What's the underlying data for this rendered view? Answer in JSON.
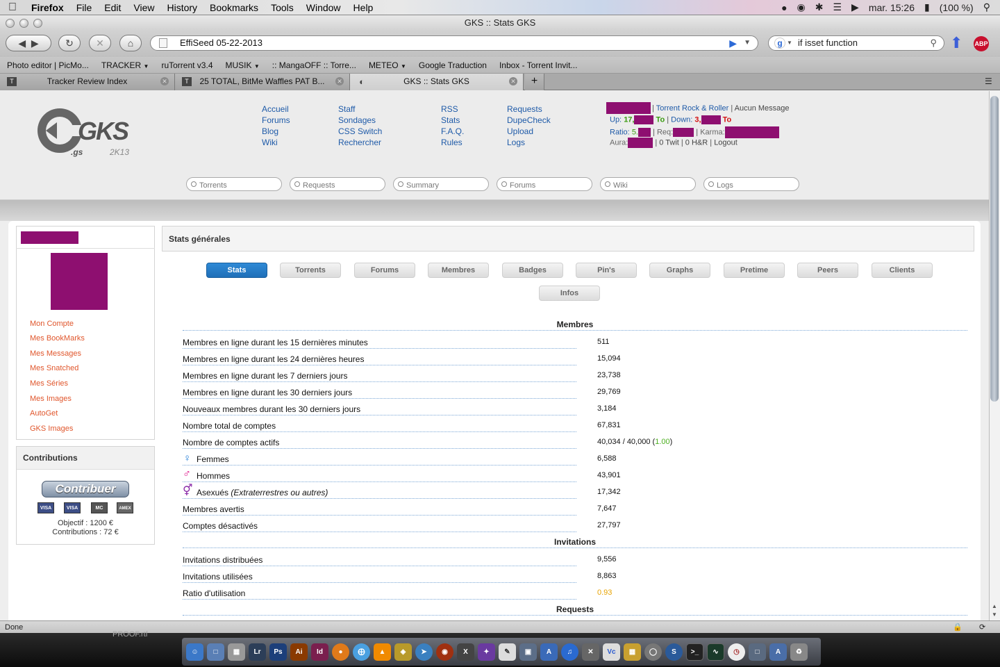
{
  "menubar": {
    "app": "Firefox",
    "items": [
      "File",
      "Edit",
      "View",
      "History",
      "Bookmarks",
      "Tools",
      "Window",
      "Help"
    ],
    "clock": "mar. 15:26",
    "battery": "(100 %)"
  },
  "window": {
    "title": "GKS :: Stats GKS"
  },
  "navbar": {
    "url": "EffiSeed 05-22-2013",
    "search_value": "if isset function"
  },
  "bookmarks": [
    "Photo editor | PicMo...",
    "TRACKER",
    "ruTorrent v3.4",
    "MUSIK",
    ":: MangaOFF :: Torre...",
    "METEO",
    "Google Traduction",
    "Inbox - Torrent Invit..."
  ],
  "tabs": [
    {
      "label": "Tracker Review Index"
    },
    {
      "label": "25 TOTAL, BitMe Waffles PAT B..."
    },
    {
      "label": "GKS :: Stats GKS"
    }
  ],
  "site": {
    "logo": {
      "main": "GKS",
      "sub": ".gs",
      "year": "2K13"
    },
    "nav": {
      "col1": [
        "Accueil",
        "Forums",
        "Blog",
        "Wiki"
      ],
      "col2": [
        "Staff",
        "Sondages",
        "CSS Switch",
        "Rechercher"
      ],
      "col3": [
        "RSS",
        "Stats",
        "F.A.Q.",
        "Rules"
      ],
      "col4": [
        "Requests",
        "DupeCheck",
        "Upload",
        "Logs"
      ]
    },
    "user": {
      "rank": "Torrent Rock & Roller",
      "messages": "Aucun Message",
      "up_label": "Up:",
      "up_value": "17,",
      "up_unit": "To",
      "down_label": "Down:",
      "down_value": "3,",
      "down_unit": "To",
      "ratio_label": "Ratio:",
      "ratio_value": "5.",
      "req_label": "Req:",
      "karma_label": "Karma:",
      "aura_label": "Aura:",
      "twit": "0 Twit",
      "hr": "0 H&R",
      "logout": "Logout"
    },
    "search_placeholders": [
      "Torrents",
      "Requests",
      "Summary",
      "Forums",
      "Wiki",
      "Logs"
    ]
  },
  "sidebar": {
    "links": [
      "Mon Compte",
      "Mes BookMarks",
      "Mes Messages",
      "Mes Snatched",
      "Mes Séries",
      "Mes Images",
      "AutoGet",
      "GKS Images"
    ],
    "contrib_title": "Contributions",
    "contrib_button": "Contribuer",
    "cards": [
      "VISA",
      "VISA",
      "MC",
      "AMEX"
    ],
    "objectif": "Objectif : 1200 €",
    "contributions": "Contributions : 72 €"
  },
  "panel": {
    "title": "Stats générales",
    "tabs": [
      "Stats",
      "Torrents",
      "Forums",
      "Membres",
      "Badges",
      "Pin's",
      "Graphs",
      "Pretime",
      "Peers",
      "Clients",
      "Infos"
    ],
    "active_tab": "Stats",
    "sections": {
      "members": "Membres",
      "invitations": "Invitations",
      "requests": "Requests"
    },
    "member_rows": [
      {
        "label": "Membres en ligne durant les 15 dernières minutes",
        "value": "511"
      },
      {
        "label": "Membres en ligne durant les 24 dernières heures",
        "value": "15,094"
      },
      {
        "label": "Membres en ligne durant les 7 derniers jours",
        "value": "23,738"
      },
      {
        "label": "Membres en ligne durant les 30 derniers jours",
        "value": "29,769"
      },
      {
        "label": "Nouveaux membres durant les 30 derniers jours",
        "value": "3,184"
      },
      {
        "label": "Nombre total de comptes",
        "value": "67,831"
      },
      {
        "label": "Nombre de comptes actifs",
        "value": "40,034 / 40,000 (",
        "extra": "1.00",
        "tail": ")"
      },
      {
        "label": "Femmes",
        "value": "6,588",
        "icon": "female-icon"
      },
      {
        "label": "Hommes",
        "value": "43,901",
        "icon": "male-icon"
      },
      {
        "label": "Asexués",
        "label_em": "(Extraterrestres ou autres)",
        "value": "17,342",
        "icon": "asexual-icon"
      },
      {
        "label": "Membres avertis",
        "value": "7,647"
      },
      {
        "label": "Comptes désactivés",
        "value": "27,797"
      }
    ],
    "invitation_rows": [
      {
        "label": "Invitations distribuées",
        "value": "9,556"
      },
      {
        "label": "Invitations utilisées",
        "value": "8,863"
      },
      {
        "label": "Ratio d'utilisation",
        "value": "0.93"
      }
    ]
  },
  "status": {
    "text": "Done",
    "dock_label": "PROOF.rtf"
  }
}
